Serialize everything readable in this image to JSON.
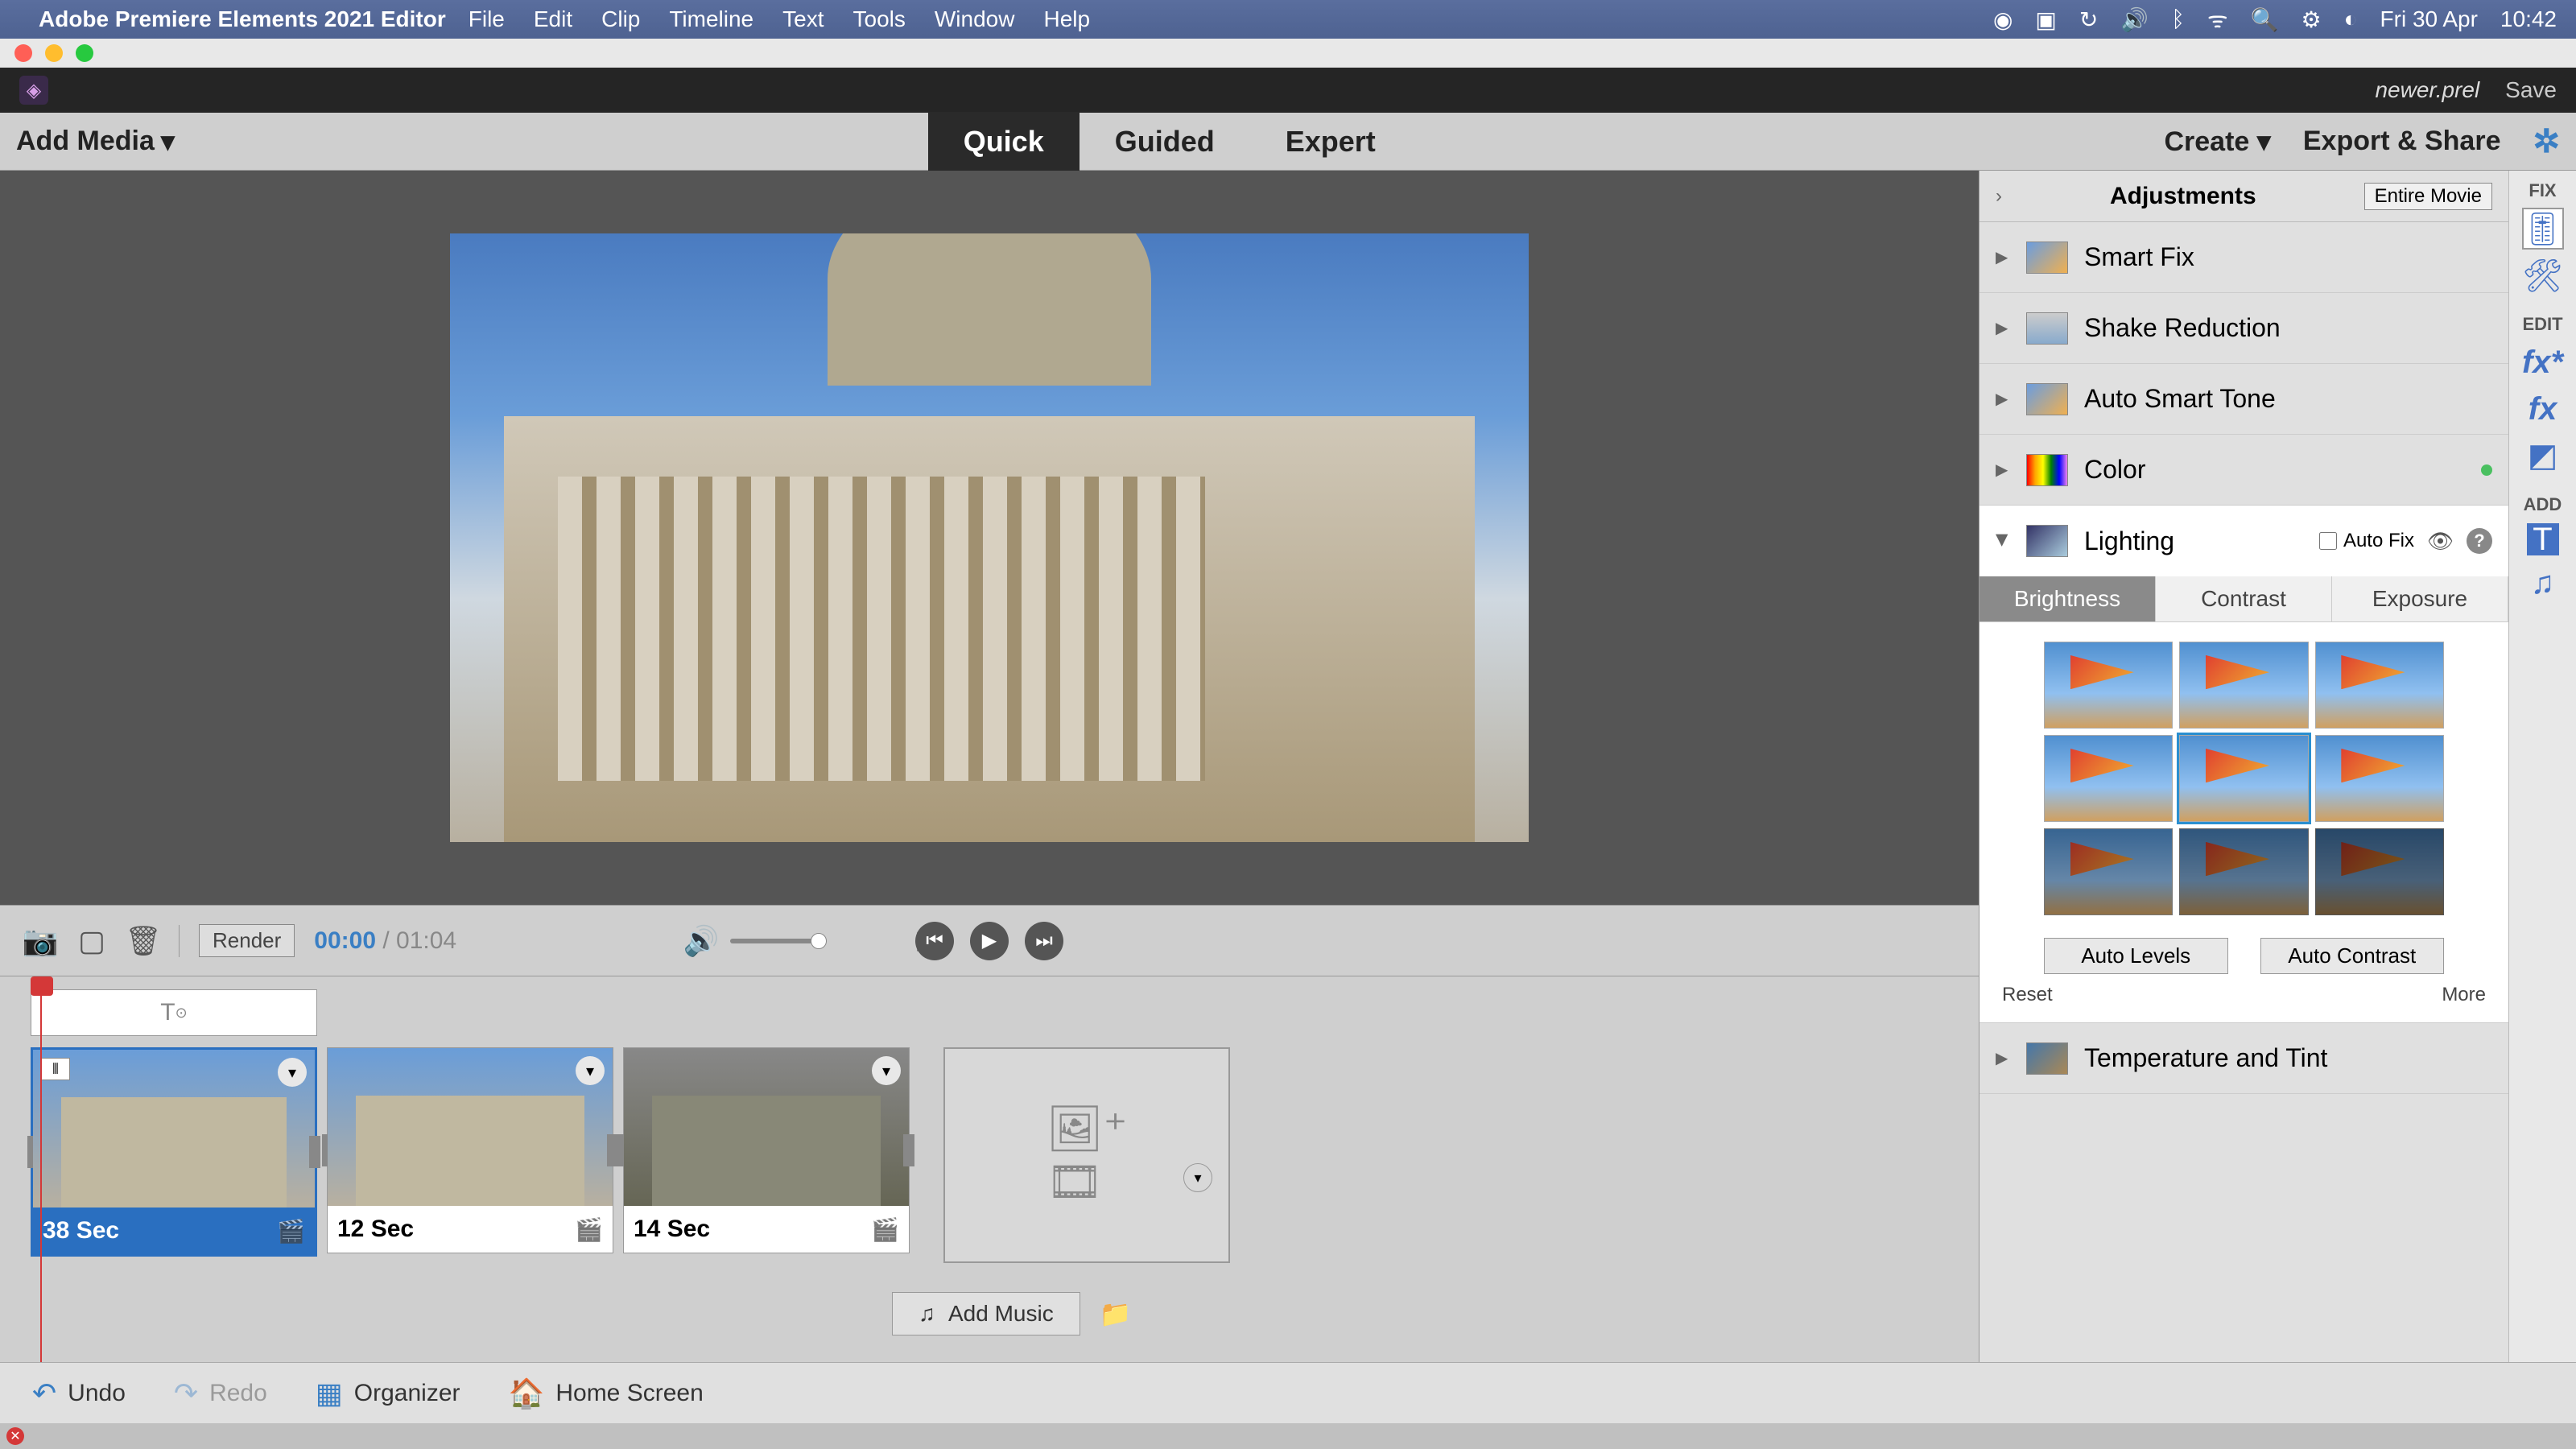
{
  "mac_menu": {
    "app_name": "Adobe Premiere Elements 2021 Editor",
    "items": [
      "File",
      "Edit",
      "Clip",
      "Timeline",
      "Text",
      "Tools",
      "Window",
      "Help"
    ],
    "date": "Fri 30 Apr",
    "time": "10:42"
  },
  "titlebar": {
    "document": "newer.prel",
    "save": "Save"
  },
  "toolbar": {
    "add_media": "Add Media",
    "modes": [
      "Quick",
      "Guided",
      "Expert"
    ],
    "active_mode": "Quick",
    "create": "Create",
    "export": "Export & Share"
  },
  "playback": {
    "render": "Render",
    "time_current": "00:00",
    "time_sep": " / ",
    "time_total": "01:04"
  },
  "timeline": {
    "clips": [
      {
        "duration": "38 Sec",
        "selected": true,
        "marker": true
      },
      {
        "duration": "12 Sec",
        "selected": false,
        "marker": false
      },
      {
        "duration": "14 Sec",
        "selected": false,
        "marker": false
      }
    ],
    "add_music": "Add Music"
  },
  "adjustments": {
    "title": "Adjustments",
    "scope": "Entire Movie",
    "items": [
      {
        "label": "Smart Fix",
        "expanded": false
      },
      {
        "label": "Shake Reduction",
        "expanded": false
      },
      {
        "label": "Auto Smart Tone",
        "expanded": false
      },
      {
        "label": "Color",
        "expanded": false,
        "active": true
      },
      {
        "label": "Lighting",
        "expanded": true
      },
      {
        "label": "Temperature and Tint",
        "expanded": false
      }
    ],
    "lighting": {
      "auto_fix": "Auto Fix",
      "sub_tabs": [
        "Brightness",
        "Contrast",
        "Exposure"
      ],
      "active_sub": "Brightness",
      "auto_levels": "Auto Levels",
      "auto_contrast": "Auto Contrast",
      "reset": "Reset",
      "more": "More"
    }
  },
  "side_rail": {
    "fix": "FIX",
    "edit": "EDIT",
    "add": "ADD"
  },
  "bottom": {
    "undo": "Undo",
    "redo": "Redo",
    "organizer": "Organizer",
    "home": "Home Screen"
  }
}
